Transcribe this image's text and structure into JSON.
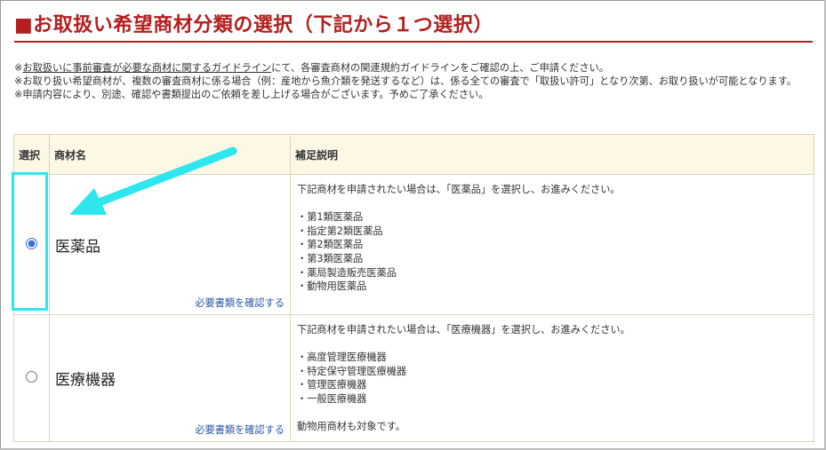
{
  "title": "■お取扱い希望商材分類の選択（下記から１つ選択）",
  "notes": {
    "note1_prefix": "※",
    "note1_link": "お取扱いに事前審査が必要な商材に関するガイドライン",
    "note1_suffix": "にて、各審査商材の関連規約ガイドラインをご確認の上、ご申請ください。",
    "note2": "※お取り扱い希望商材が、複数の審査商材に係る場合（例：産地から魚介類を発送するなど）は、係る全ての審査で「取扱い許可」となり次第、お取り扱いが可能となります。",
    "note3": "※申請内容により、別途、確認や書類提出のご依頼を差し上げる場合がございます。予めご了承ください。"
  },
  "table": {
    "headers": {
      "select": "選択",
      "name": "商材名",
      "description": "補足説明"
    },
    "rows": [
      {
        "name": "医薬品",
        "selected": true,
        "doc_link": "必要書類を確認する",
        "intro": "下記商材を申請されたい場合は、「医薬品」を選択し、お進みください。",
        "items": [
          "・第1類医薬品",
          "・指定第2類医薬品",
          "・第2類医薬品",
          "・第3類医薬品",
          "・薬局製造販売医薬品",
          "・動物用医薬品"
        ],
        "extra": ""
      },
      {
        "name": "医療機器",
        "selected": false,
        "doc_link": "必要書類を確認する",
        "intro": "下記商材を申請されたい場合は、「医療機器」を選択し、お進みください。",
        "items": [
          "・高度管理医療機器",
          "・特定保守管理医療機器",
          "・管理医療機器",
          "・一般医療機器"
        ],
        "extra": "動物用商材も対象です。"
      }
    ]
  },
  "colors": {
    "title_red": "#b41e1e",
    "header_bg": "#fdf8e6",
    "link_blue": "#2a56a8",
    "annotation_cyan": "#2ee6ee"
  }
}
